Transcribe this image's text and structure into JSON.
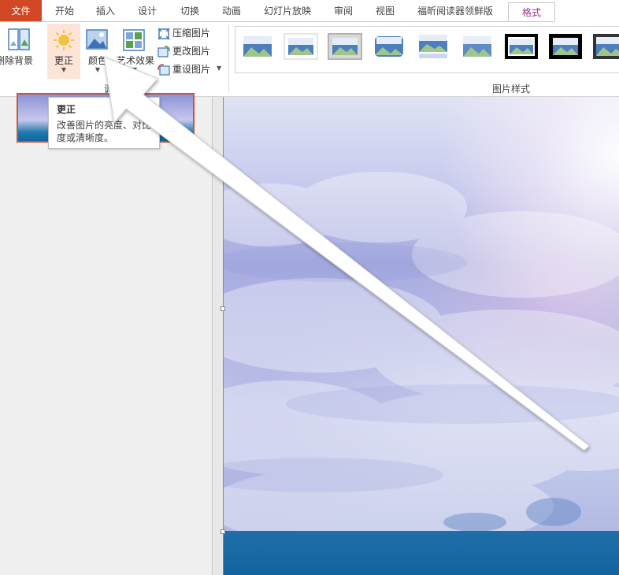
{
  "tabs": [
    "文件",
    "开始",
    "插入",
    "设计",
    "切换",
    "动画",
    "幻灯片放映",
    "审阅",
    "视图",
    "福昕阅读器领鲜版",
    "格式"
  ],
  "ribbon": {
    "adjust": {
      "remove_bg": "删除背景",
      "corrections": "更正",
      "color": "颜色",
      "artistic_effects": "艺术效果",
      "compress": "压缩图片",
      "change": "更改图片",
      "reset": "重设图片",
      "group_label": "调整"
    },
    "styles": {
      "group_label": "图片样式"
    }
  },
  "tooltip": {
    "title": "更正",
    "body": "改善图片的亮度、对比度或清晰度。"
  },
  "colors": {
    "file_tab": "#d24726",
    "active_tab_text": "#9e2d87",
    "highlight": "#fce4d6",
    "thumb_border": "#d35230"
  }
}
